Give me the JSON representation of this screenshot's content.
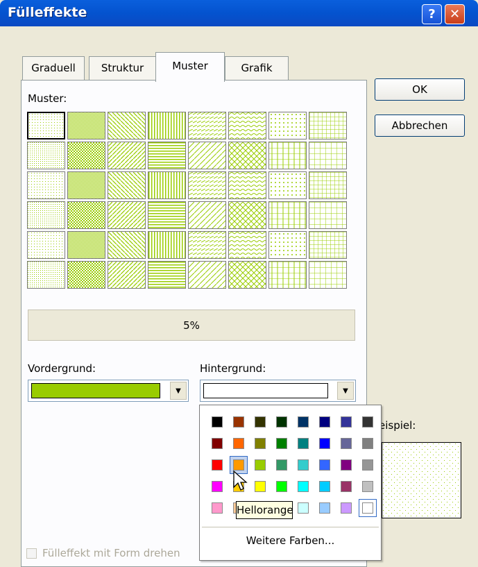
{
  "window": {
    "title": "Fülleffekte"
  },
  "title_buttons": {
    "help": "?",
    "close": "✕"
  },
  "tabs": [
    {
      "label": "Graduell"
    },
    {
      "label": "Struktur"
    },
    {
      "label": "Muster",
      "active": true
    },
    {
      "label": "Grafik"
    }
  ],
  "pattern_section": {
    "label": "Muster:",
    "selected_name": "5%"
  },
  "foreground": {
    "label": "Vordergrund:",
    "color": "#99cc00"
  },
  "background": {
    "label": "Hintergrund:",
    "color": "#ffffff"
  },
  "buttons": {
    "ok": "OK",
    "cancel": "Abbrechen"
  },
  "sample": {
    "label": "Beispiel:",
    "label_visible": "eispiel:"
  },
  "checkbox": {
    "label": "Fülleffekt mit Form drehen",
    "checked": false,
    "enabled": false
  },
  "color_popup": {
    "rows": [
      [
        "#000000",
        "#993300",
        "#333300",
        "#003300",
        "#003366",
        "#000080",
        "#333399",
        "#333333"
      ],
      [
        "#800000",
        "#ff6600",
        "#808000",
        "#008000",
        "#008080",
        "#0000ff",
        "#666699",
        "#808080"
      ],
      [
        "#ff0000",
        "#ff9900",
        "#99cc00",
        "#339966",
        "#33cccc",
        "#3366ff",
        "#800080",
        "#969696"
      ],
      [
        "#ff00ff",
        "#ffcc00",
        "#ffff00",
        "#00ff00",
        "#00ffff",
        "#00ccff",
        "#993366",
        "#c0c0c0"
      ],
      [
        "#ff99cc",
        "#ffcc99",
        "#ffff99",
        "#ccffcc",
        "#ccffff",
        "#99ccff",
        "#cc99ff",
        "#ffffff"
      ]
    ],
    "hovered": "Hellorange",
    "more_colors": "Weitere Farben..."
  },
  "tooltip": {
    "text": "Hellorange"
  },
  "colors": {
    "pattern_fg": "#99cc00",
    "pattern_bg": "#ffffff",
    "titlebar": "#0453cf",
    "dialog_bg": "#ece9d8"
  }
}
